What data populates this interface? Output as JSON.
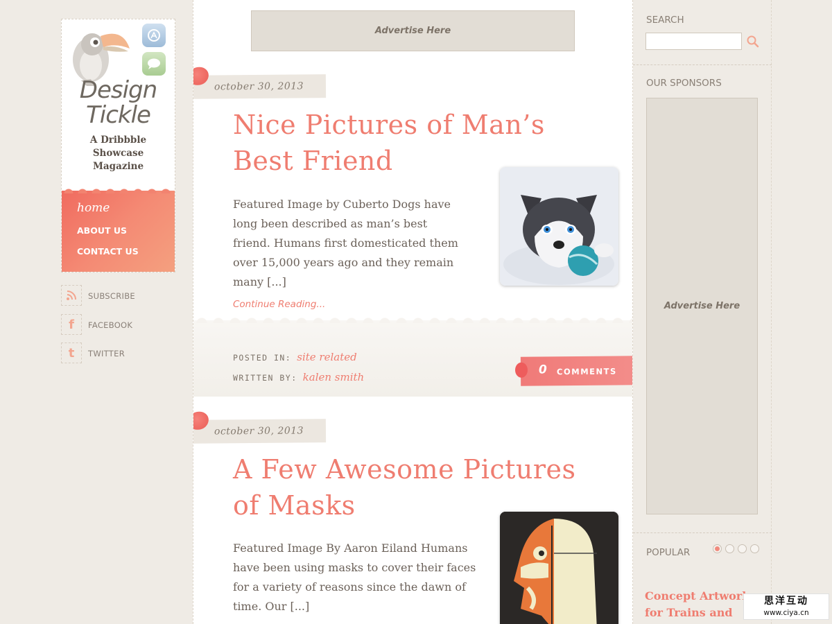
{
  "site": {
    "title_line1": "Design",
    "title_line2": "Tickle",
    "tagline": "A Dribbble Showcase Magazine"
  },
  "nav": {
    "home": "home",
    "about": "ABOUT US",
    "contact": "CONTACT US"
  },
  "social": [
    {
      "label": "SUBSCRIBE",
      "icon": "rss-icon"
    },
    {
      "label": "FACEBOOK",
      "icon": "facebook-icon"
    },
    {
      "label": "TWITTER",
      "icon": "twitter-icon"
    }
  ],
  "ads": {
    "top": "Advertise Here",
    "side": "Advertise Here"
  },
  "posts": [
    {
      "date": "october 30, 2013",
      "title": "Nice Pictures of Man’s Best Friend",
      "excerpt": "Featured Image by Cuberto Dogs have long been described as man’s best friend. Humans first domesticated them over 15,000 years ago and they remain many [...]",
      "continue": "Continue Reading...",
      "posted_in_label": "POSTED IN:",
      "posted_in": "site related",
      "written_by_label": "WRITTEN BY:",
      "written_by": "kalen smith",
      "comment_count": "0",
      "comment_label": "COMMENTS",
      "thumb": "husky-puppy-image"
    },
    {
      "date": "october 30, 2013",
      "title": "A Few Awesome Pictures of Masks",
      "excerpt": "Featured Image By Aaron Eiland Humans have been using masks to cover their faces for a variety of reasons since the dawn of time. Our [...]",
      "thumb": "tiger-mask-image"
    }
  ],
  "sidebar": {
    "search_title": "SEARCH",
    "search_placeholder": "",
    "sponsors_title": "OUR SPONSORS",
    "popular_title": "POPULAR",
    "popular_item": "Concept Artwork for Trains and"
  },
  "watermark": {
    "line1": "思洋互动",
    "line2": "www.ciya.cn"
  },
  "colors": {
    "accent": "#ef7d70",
    "nav_bg": "#f06b5f",
    "page_bg": "#efebe5"
  }
}
